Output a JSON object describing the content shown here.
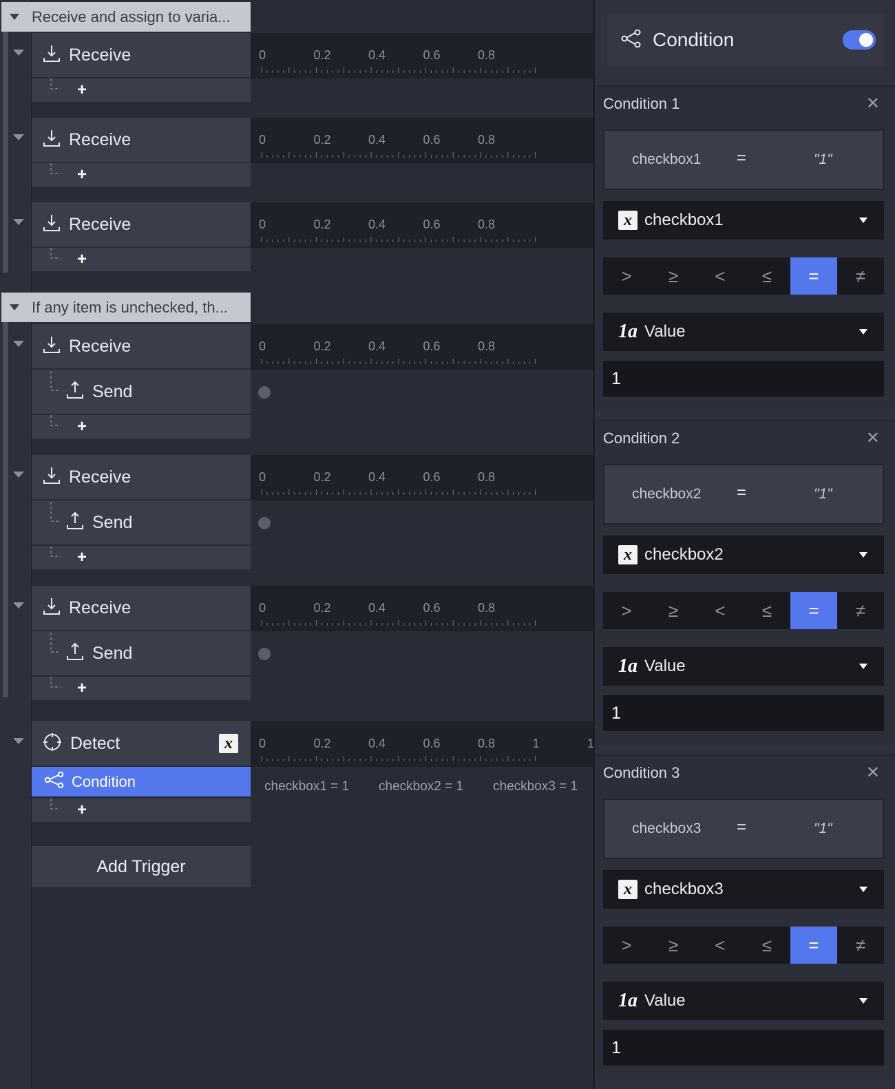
{
  "timeline": {
    "groups": [
      {
        "title": "Receive and assign to varia..."
      },
      {
        "title": "If any item is unchecked, th..."
      }
    ],
    "receive_label": "Receive",
    "send_label": "Send",
    "detect_label": "Detect",
    "condition_label": "Condition",
    "add_label": "+",
    "add_trigger_label": "Add Trigger",
    "ruler_ticks": [
      "0",
      "0.2",
      "0.4",
      "0.6",
      "0.8"
    ],
    "detect_ruler_ticks": [
      "0",
      "0.2",
      "0.4",
      "0.6",
      "0.8",
      "1",
      "1"
    ],
    "condition_outputs": [
      "checkbox1 = 1",
      "checkbox2 = 1",
      "checkbox3 = 1"
    ]
  },
  "panel": {
    "title": "Condition",
    "enabled": true,
    "conditions": [
      {
        "title": "Condition 1",
        "variable": "checkbox1",
        "operator": "=",
        "value_display": "\"1\"",
        "value_type": "Value",
        "value": "1"
      },
      {
        "title": "Condition 2",
        "variable": "checkbox2",
        "operator": "=",
        "value_display": "\"1\"",
        "value_type": "Value",
        "value": "1"
      },
      {
        "title": "Condition 3",
        "variable": "checkbox3",
        "operator": "=",
        "value_display": "\"1\"",
        "value_type": "Value",
        "value": "1"
      }
    ],
    "operators": [
      ">",
      "≥",
      "<",
      "≤",
      "=",
      "≠"
    ],
    "active_operator": "=",
    "close_glyph": "✕",
    "var_badge": "x",
    "type_badge": "1a"
  },
  "colors": {
    "accent": "#5477ee",
    "background": "#292c37",
    "block": "#3a3e4b",
    "ruler": "#1f2128"
  }
}
